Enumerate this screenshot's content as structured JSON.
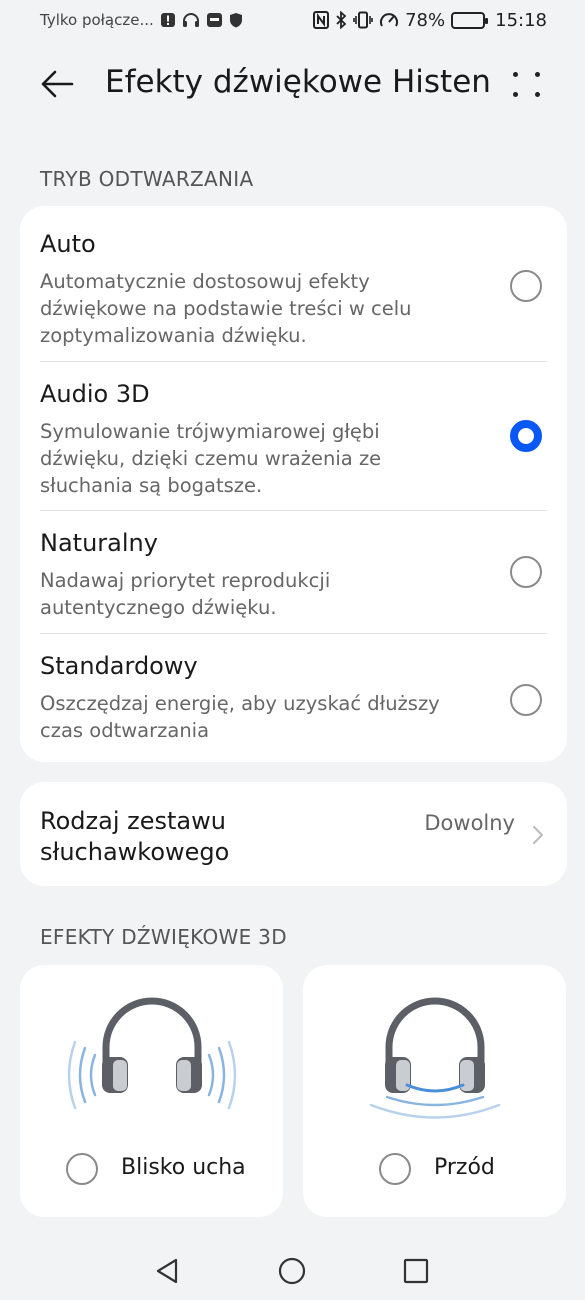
{
  "status_bar": {
    "carrier": "Tylko połącze...",
    "battery_percent_label": "78%",
    "battery_level": 0.78,
    "time": "15:18",
    "icons": [
      "alert-icon",
      "headphones-icon",
      "sim-icon",
      "shield-icon",
      "nfc-icon",
      "bluetooth-icon",
      "vibrate-icon",
      "speedometer-icon",
      "battery-icon"
    ]
  },
  "app_bar": {
    "title": "Efekty dźwiękowe Histen"
  },
  "playback_mode": {
    "header": "TRYB ODTWARZANIA",
    "options": [
      {
        "title": "Auto",
        "description": "Automatycznie dostosowuj efekty dźwiękowe na podstawie treści w celu zoptymalizowania dźwięku.",
        "selected": false
      },
      {
        "title": "Audio 3D",
        "description": "Symulowanie trójwymiarowej głębi dźwięku, dzięki czemu wrażenia ze słuchania są bogatsze.",
        "selected": true
      },
      {
        "title": "Naturalny",
        "description": "Nadawaj priorytet reprodukcji autentycznego dźwięku.",
        "selected": false
      },
      {
        "title": "Standardowy",
        "description": "Oszczędzaj energię, aby uzyskać dłuższy czas odtwarzania",
        "selected": false
      }
    ]
  },
  "headset_type": {
    "label": "Rodzaj zestawu słuchawkowego",
    "value": "Dowolny"
  },
  "effects_3d": {
    "header": "EFEKTY DŹWIĘKOWE 3D",
    "options": [
      {
        "label": "Blisko ucha",
        "selected": false
      },
      {
        "label": "Przód",
        "selected": false
      }
    ]
  },
  "colors": {
    "accent": "#0a59f7",
    "background": "#f1f3f5",
    "card": "#ffffff",
    "illustration_wave": "#8ab4e0"
  }
}
